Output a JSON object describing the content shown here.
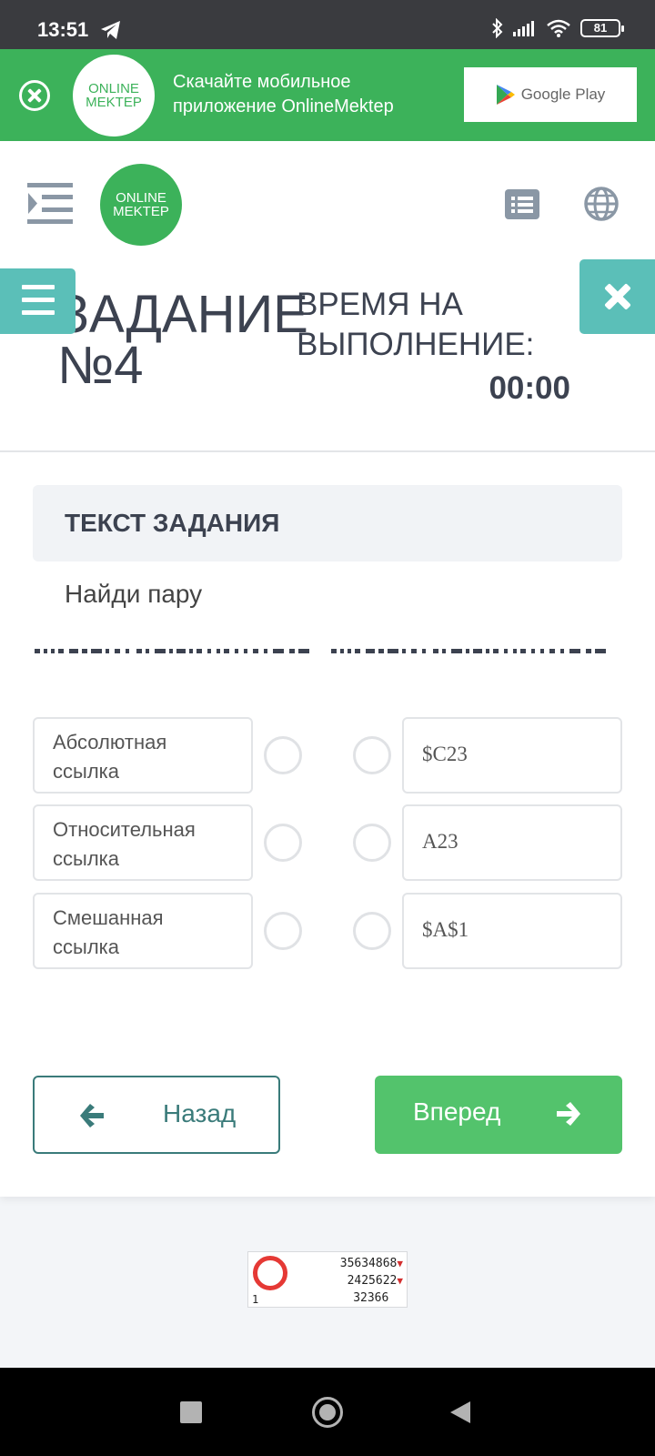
{
  "status_bar": {
    "time": "13:51",
    "battery": "81"
  },
  "banner": {
    "logo_line1": "ONLINE",
    "logo_line2": "MEKTEP",
    "text_line1": "Скачайте мобильное",
    "text_line2": "приложение OnlineMektep",
    "store_label": "Google Play"
  },
  "header": {
    "logo_line1": "ONLINE",
    "logo_line2": "MEKTEP"
  },
  "task": {
    "title_line1": "ЗАДАНИЕ",
    "title_line2": "№4",
    "time_label_line1": "ВРЕМЯ НА",
    "time_label_line2": "ВЫПОЛНЕНИЕ:",
    "time_value": "00:00",
    "section_title": "ТЕКСТ ЗАДАНИЯ",
    "instruction": "Найди пару"
  },
  "matching": {
    "left": [
      "Абсолютная\nссылка",
      "Относительная\nссылка",
      "Смешанная\nссылка"
    ],
    "right": [
      "$C23",
      "A23",
      "$A$1"
    ]
  },
  "navigation": {
    "back_label": "Назад",
    "next_label": "Вперед"
  },
  "counter": {
    "row1": "35634868",
    "row2": "2425622",
    "row3": "32366",
    "corner": "1"
  },
  "colors": {
    "brand_green": "#3cb25a",
    "teal": "#5bbfb8",
    "next_button": "#53c36c",
    "back_border": "#3a7b7a"
  }
}
